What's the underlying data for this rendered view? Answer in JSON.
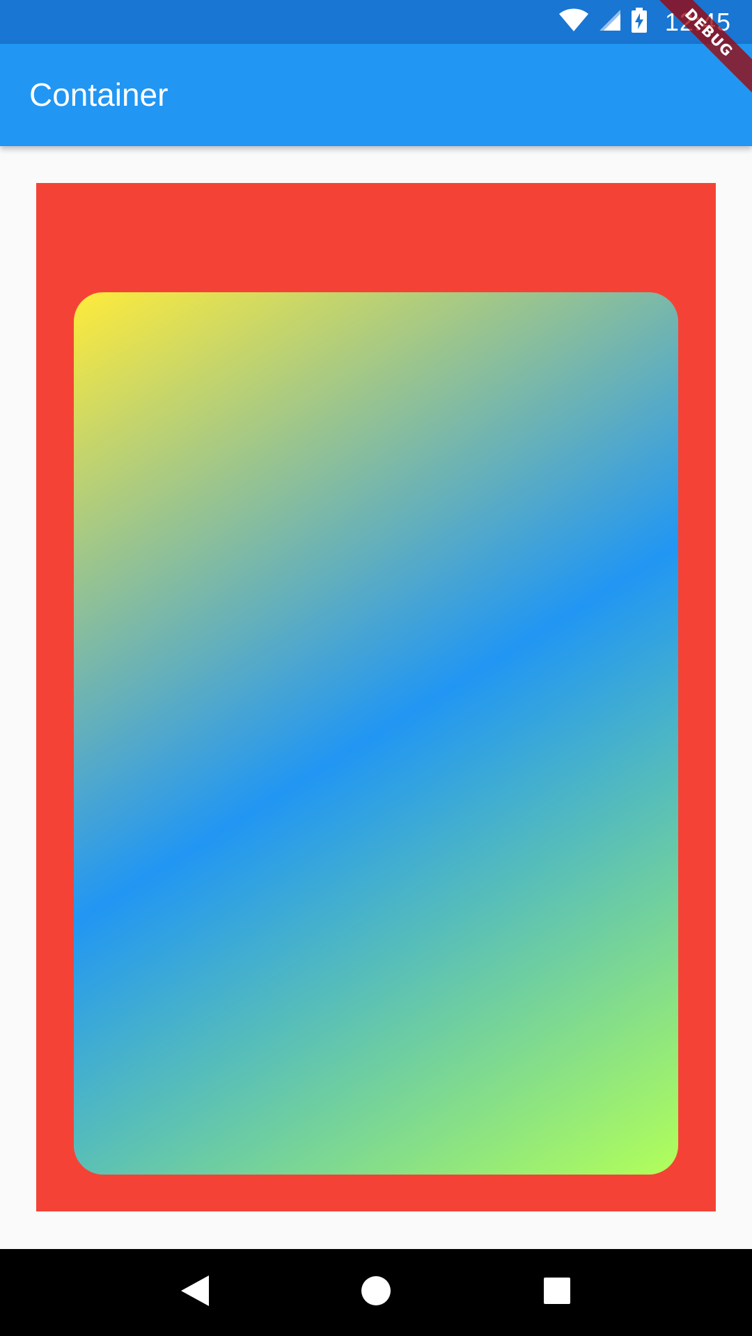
{
  "status_bar": {
    "time": "12:45",
    "icons": [
      "wifi-icon",
      "cell-signal-icon",
      "battery-charging-icon"
    ],
    "color": "#1976d2"
  },
  "app_bar": {
    "title": "Container",
    "color": "#2196f3"
  },
  "debug_banner": {
    "label": "DEBUG"
  },
  "content": {
    "outer_container_color": "#f44336",
    "gradient_colors": [
      "#ffeb3b",
      "#2196f3",
      "#b2ff59"
    ]
  },
  "nav_bar": {
    "buttons": [
      "back-icon",
      "home-icon",
      "recents-icon"
    ]
  }
}
